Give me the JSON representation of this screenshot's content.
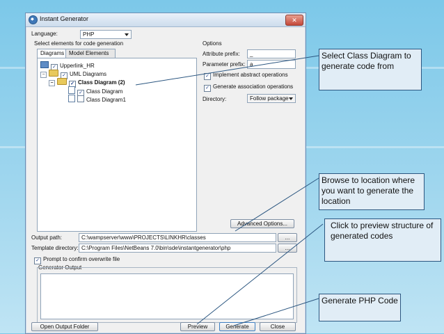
{
  "window": {
    "title": "Instant Generator",
    "close_glyph": "✕"
  },
  "form": {
    "language_label": "Language:",
    "language_value": "PHP",
    "select_elements_label": "Select elements for code generation",
    "options_label": "Options",
    "tabs": [
      "Diagrams",
      "Model Elements"
    ],
    "tree": [
      {
        "label": "Upperlink_HR",
        "icon": "project-icon",
        "checked": true
      },
      {
        "label": "UML Diagrams",
        "icon": "folder-icon",
        "checked": true
      },
      {
        "label": "Class Diagram (2)",
        "icon": "folder-icon",
        "checked": true
      },
      {
        "label": "Class Diagram",
        "icon": "diagram-icon",
        "checked": true
      },
      {
        "label": "Class Diagram1",
        "icon": "diagram-icon",
        "checked": false
      }
    ],
    "attribute_prefix_label": "Attribute prefix:",
    "attribute_prefix_value": "_",
    "parameter_prefix_label": "Parameter prefix:",
    "parameter_prefix_value": "a",
    "implement_abstract_label": "Implement abstract operations",
    "generate_association_label": "Generate association operations",
    "directory_label": "Directory:",
    "directory_value": "Follow package",
    "advanced_options_button": "Advanced Options...",
    "output_path_label": "Output path:",
    "output_path_value": "C:\\wampserver\\www\\PROJECTS\\LINKHR\\classes",
    "template_directory_label": "Template directory:",
    "template_directory_value": "C:\\Program Files\\NetBeans 7.0\\bin\\sde\\instantgenerator\\php",
    "browse_button": "...",
    "prompt_overwrite_label": "Prompt to confirm overwrite file",
    "generator_output_label": "Generator Output",
    "open_output_folder_button": "Open Output Folder",
    "preview_button": "Preview",
    "generate_button": "Generate",
    "close_button": "Close"
  },
  "callouts": {
    "select_class": "Select Class Diagram to generate code from",
    "browse_location": "Browse to location where you want to generate the location",
    "preview": "Click to preview structure of generated codes",
    "generate": "Generate PHP Code"
  },
  "colors": {
    "background": "#9fd6ee",
    "callout_fill": "#e1edf6",
    "callout_border": "#2b5680",
    "line": "#2b5680"
  }
}
